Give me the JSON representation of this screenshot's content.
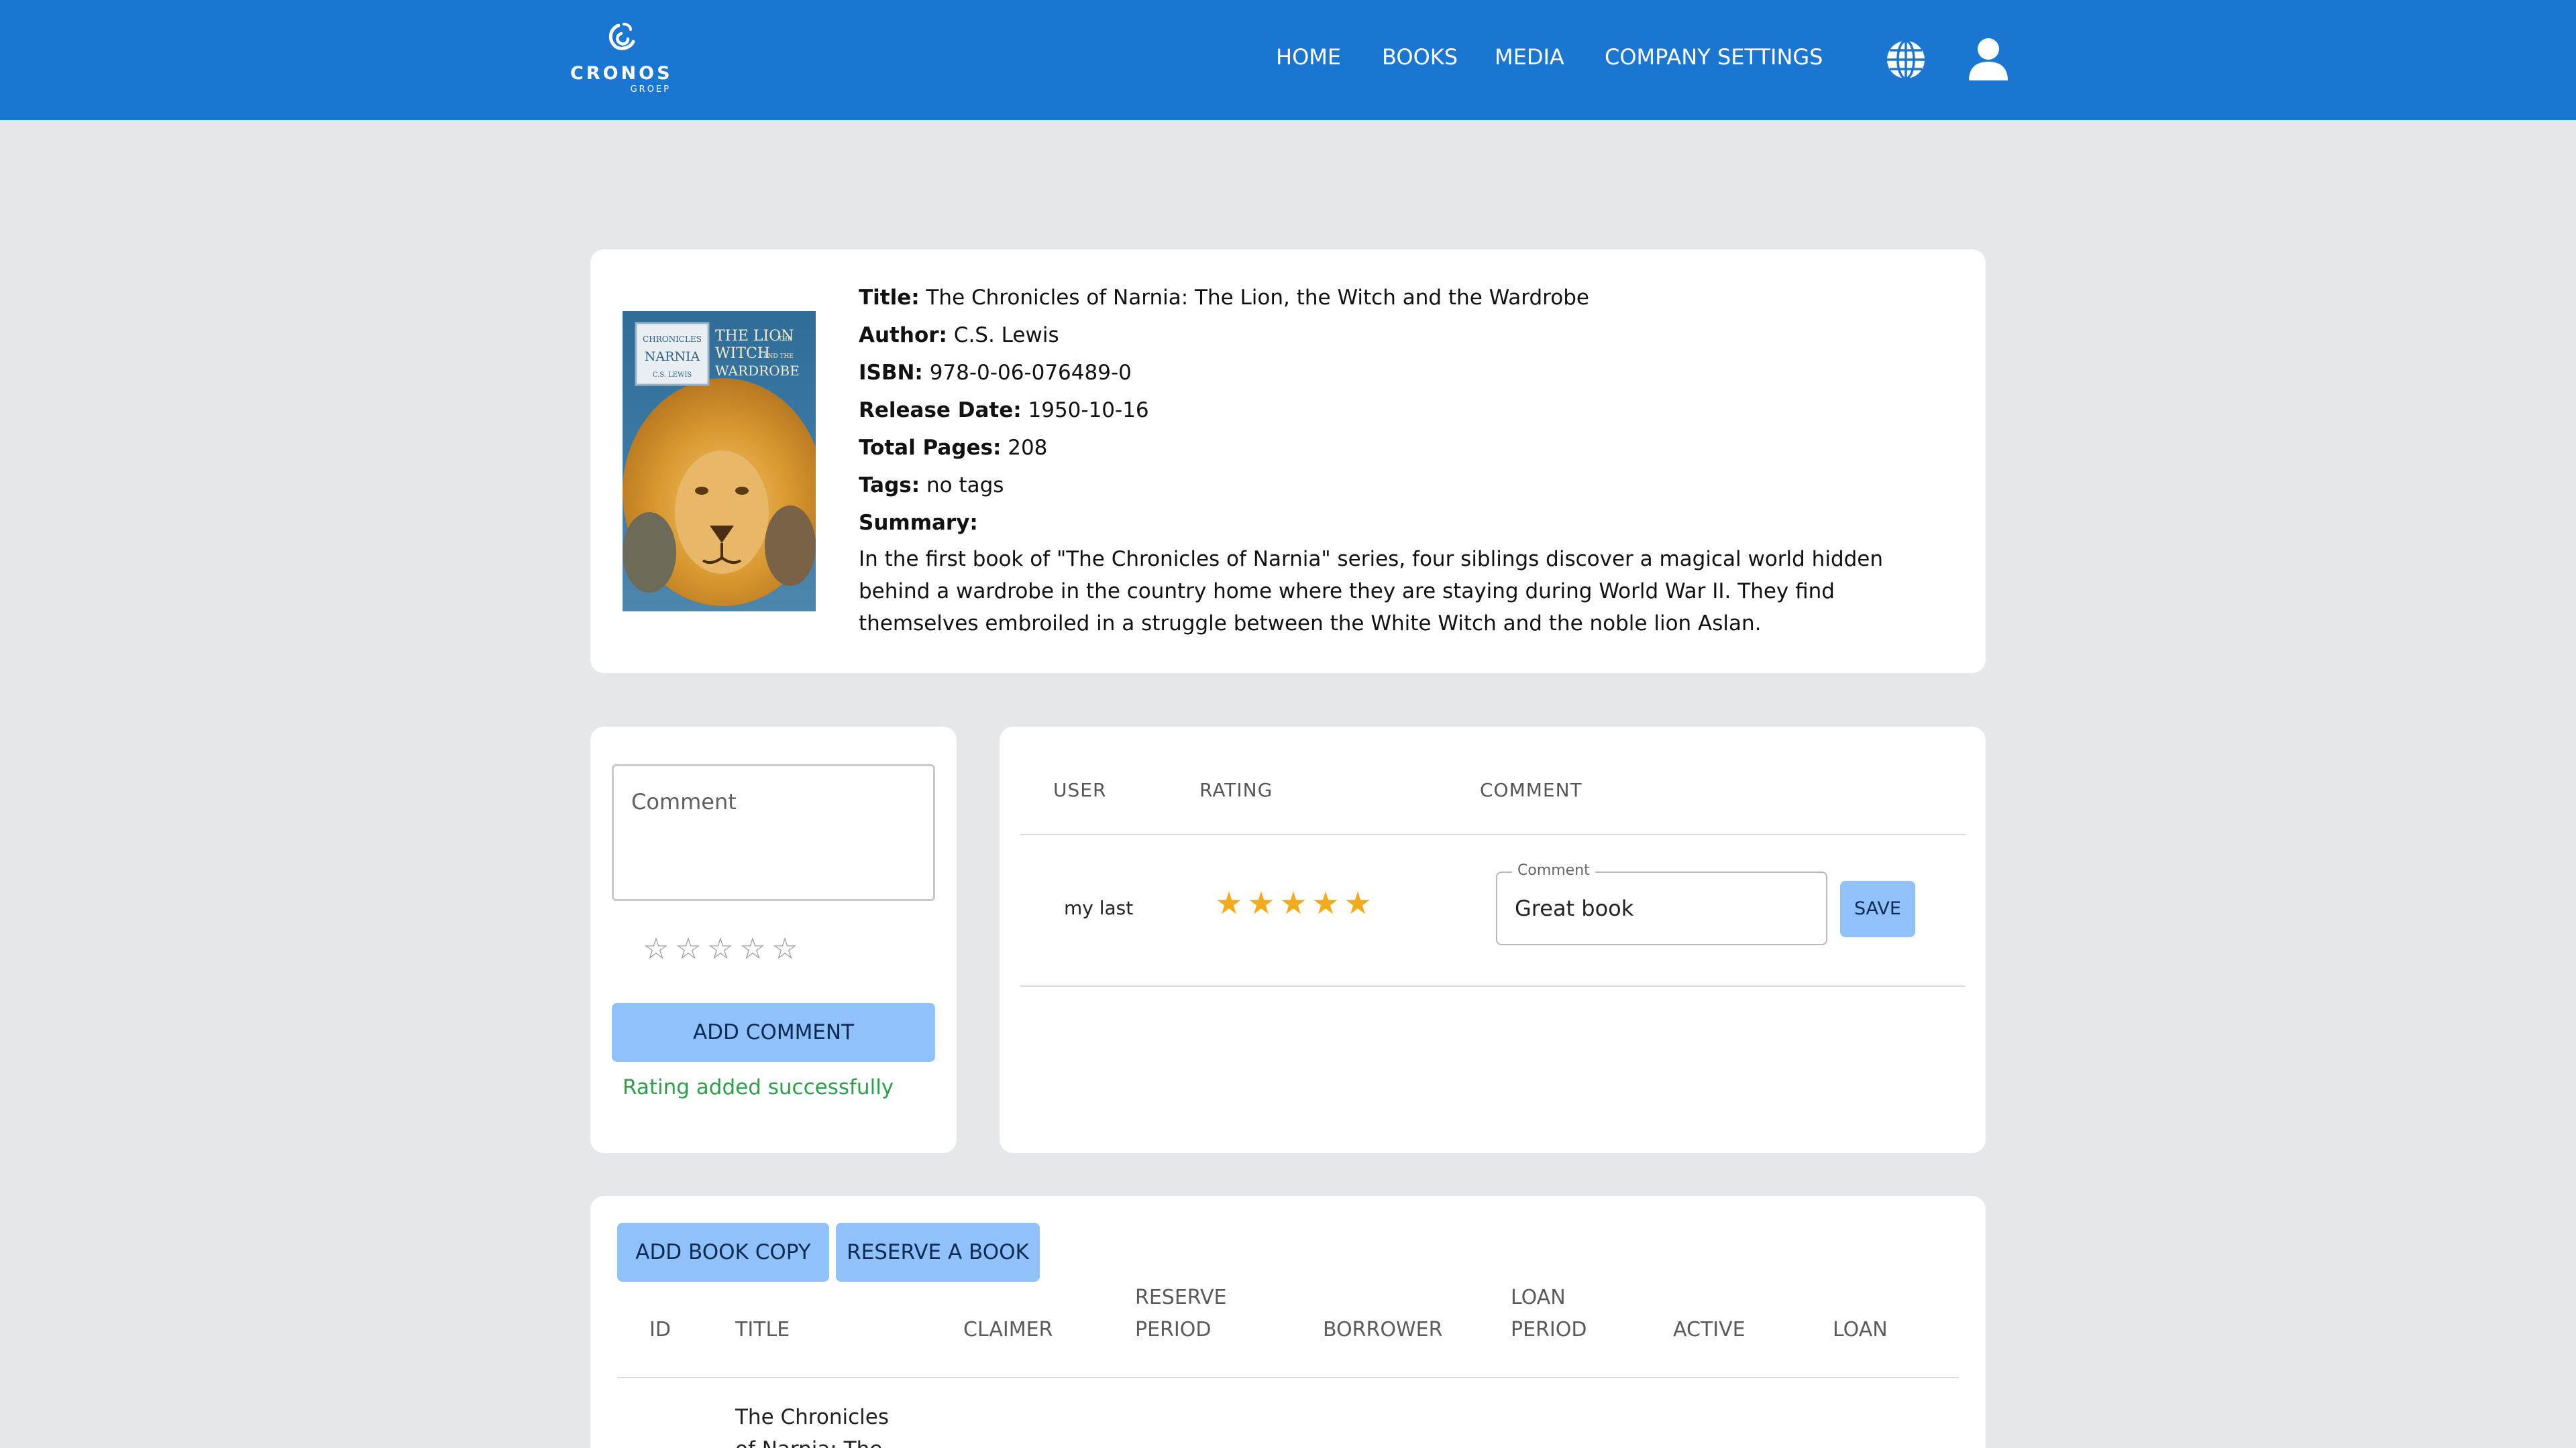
{
  "brand": {
    "name": "CRONOS",
    "sub": "GROEP"
  },
  "nav": {
    "items": [
      "HOME",
      "BOOKS",
      "MEDIA",
      "COMPANY SETTINGS"
    ]
  },
  "book": {
    "cover_title_line1": "CHRONICLES",
    "cover_title_line2": "NARNIA",
    "cover_author": "C.S. LEWIS",
    "cover_subtitle_1": "THE LION",
    "cover_subtitle_2": "WITCH",
    "cover_subtitle_3": "WARDROBE",
    "cover_the": "THE",
    "cover_and_the": "AND THE",
    "title_label": "Title:",
    "title": "The Chronicles of Narnia: The Lion, the Witch and the Wardrobe",
    "author_label": "Author:",
    "author": "C.S. Lewis",
    "isbn_label": "ISBN:",
    "isbn": "978-0-06-076489-0",
    "release_label": "Release Date:",
    "release_date": "1950-10-16",
    "pages_label": "Total Pages:",
    "pages": "208",
    "tags_label": "Tags:",
    "tags": "no tags",
    "summary_label": "Summary:",
    "summary": "In the first book of \"The Chronicles of Narnia\" series, four siblings discover a magical world hidden behind a wardrobe in the country home where they are staying during World War II. They find themselves embroiled in a struggle between the White Witch and the noble lion Aslan."
  },
  "comment_form": {
    "placeholder": "Comment",
    "star_empty": "☆",
    "star_count": 5,
    "selected_rating": 0,
    "add_button": "ADD COMMENT",
    "success_message": "Rating added successfully"
  },
  "ratings": {
    "headers": {
      "user": "USER",
      "rating": "RATING",
      "comment": "COMMENT"
    },
    "rows": [
      {
        "user": "my last",
        "rating": 5,
        "star_filled": "★",
        "comment_label": "Comment",
        "comment": "Great book",
        "save": "SAVE"
      }
    ]
  },
  "copies": {
    "add_button": "ADD BOOK COPY",
    "reserve_button": "RESERVE A BOOK",
    "headers": {
      "id": "ID",
      "title": "TITLE",
      "claimer": "CLAIMER",
      "reserve_period_1": "RESERVE",
      "reserve_period_2": "PERIOD",
      "borrower": "BORROWER",
      "loan_period_1": "LOAN",
      "loan_period_2": "PERIOD",
      "active": "ACTIVE",
      "loan": "LOAN"
    },
    "rows": [
      {
        "title_line1": "The Chronicles",
        "title_line2": "of Narnia: The"
      }
    ]
  },
  "colors": {
    "topbar": "#1b76d1",
    "page_bg": "#e6e7eb",
    "button": "#90c1fa",
    "star": "#f5a81a",
    "success": "#2f9e4b"
  }
}
